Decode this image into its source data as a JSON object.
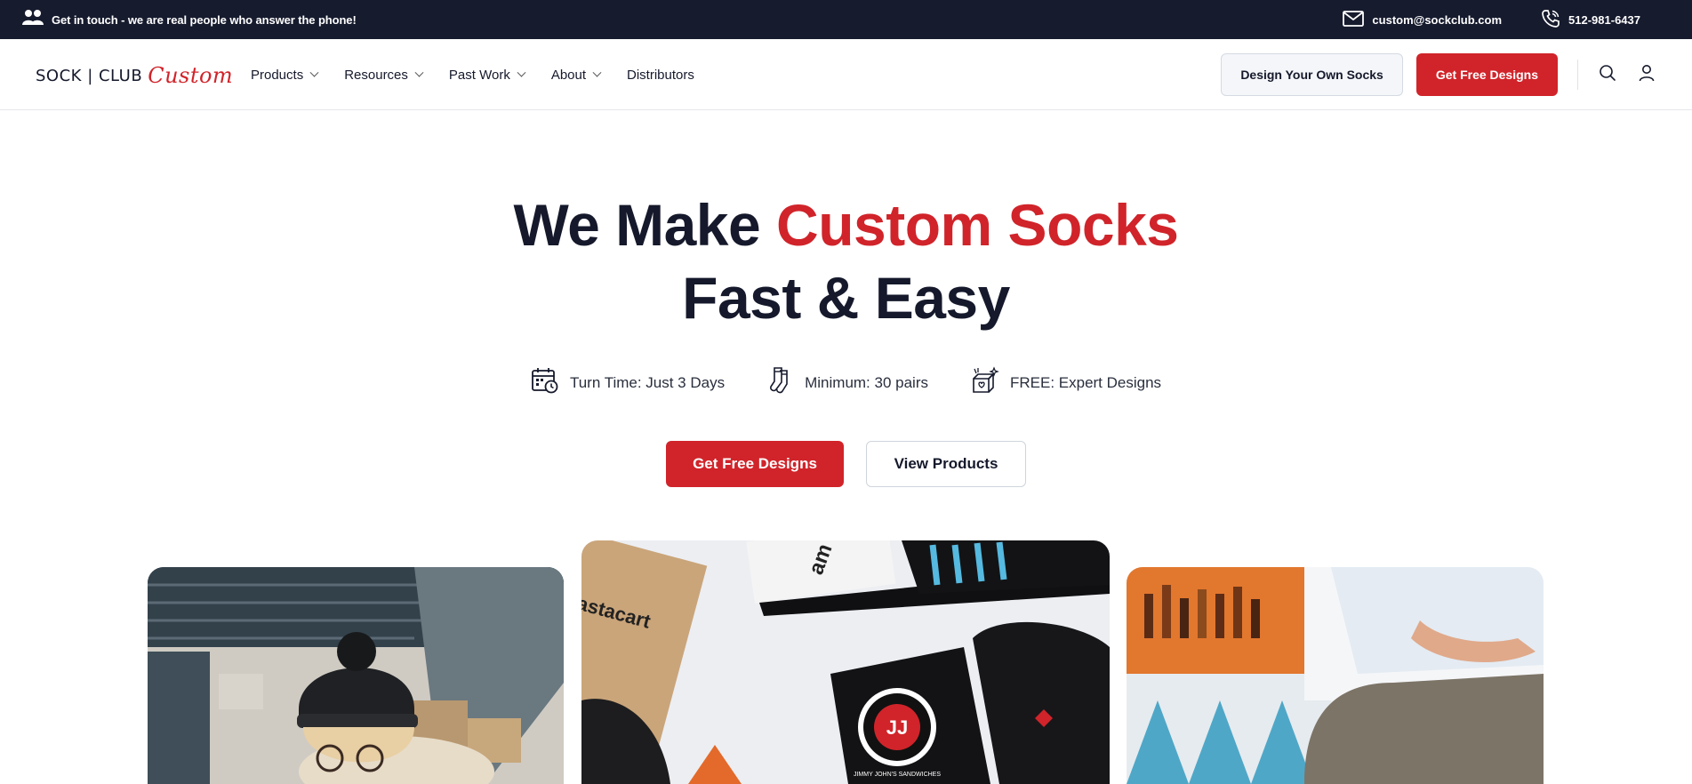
{
  "topbar": {
    "message": "Get in touch - we are real people who answer the phone!",
    "email": "custom@sockclub.com",
    "phone": "512-981-6437"
  },
  "header": {
    "logo_main": "SOCK | CLUB",
    "logo_script": "Custom",
    "nav": [
      {
        "label": "Products",
        "has_dropdown": true
      },
      {
        "label": "Resources",
        "has_dropdown": true
      },
      {
        "label": "Past Work",
        "has_dropdown": true
      },
      {
        "label": "About",
        "has_dropdown": true
      },
      {
        "label": "Distributors",
        "has_dropdown": false
      }
    ],
    "design_button": "Design Your Own Socks",
    "free_designs_button": "Get Free Designs"
  },
  "hero": {
    "title_line1_plain": "We Make ",
    "title_line1_accent": "Custom Socks",
    "title_line2": "Fast & Easy",
    "features": [
      {
        "icon": "calendar-clock-icon",
        "label": "Turn Time: Just 3 Days"
      },
      {
        "icon": "socks-icon",
        "label": "Minimum: 30 pairs"
      },
      {
        "icon": "design-box-icon",
        "label": "FREE: Expert Designs"
      }
    ],
    "primary_cta": "Get Free Designs",
    "secondary_cta": "View Products"
  },
  "gallery": {
    "middle_print_text_1": "astacart",
    "middle_print_text_2": "am",
    "middle_logo_ring": "JIMMY JOHN'S SANDWICHES",
    "middle_logo_letters": "JJ"
  },
  "colors": {
    "brand_red": "#d0242a",
    "dark_navy": "#161b2e",
    "text_dark": "#15192b"
  }
}
